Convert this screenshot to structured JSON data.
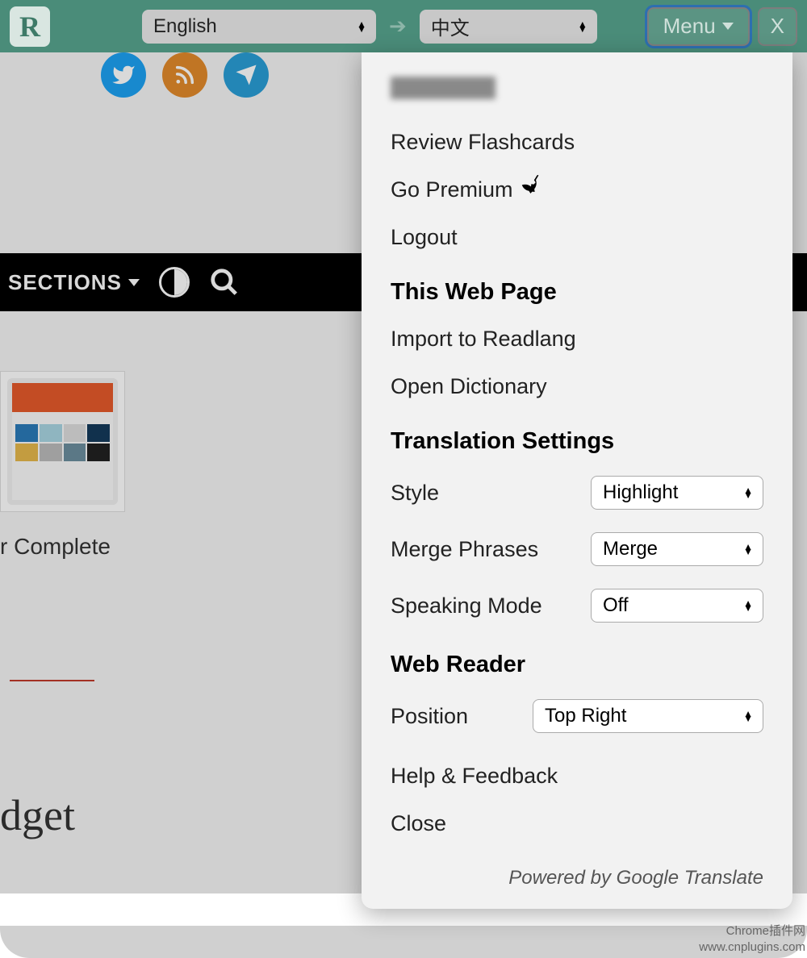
{
  "topbar": {
    "logo_letter": "R",
    "source_lang": "English",
    "target_lang": "中文",
    "menu_label": "Menu",
    "close_label": "X"
  },
  "social": {
    "twitter": "twitter-icon",
    "rss": "rss-icon",
    "telegram": "telegram-icon"
  },
  "sections_bar": {
    "label": "SECTIONS"
  },
  "article": {
    "title_fragment": "r Complete",
    "big_title_fragment": "dget"
  },
  "menu": {
    "review_flashcards": "Review Flashcards",
    "go_premium": "Go Premium",
    "logout": "Logout",
    "this_web_page_header": "This Web Page",
    "import_to_readlang": "Import to Readlang",
    "open_dictionary": "Open Dictionary",
    "translation_settings_header": "Translation Settings",
    "style_label": "Style",
    "style_value": "Highlight",
    "merge_label": "Merge Phrases",
    "merge_value": "Merge",
    "speaking_label": "Speaking Mode",
    "speaking_value": "Off",
    "web_reader_header": "Web Reader",
    "position_label": "Position",
    "position_value": "Top Right",
    "help_feedback": "Help & Feedback",
    "close": "Close",
    "powered_by": "Powered by Google Translate"
  },
  "footer": {
    "line1": "Chrome插件网",
    "line2": "www.cnplugins.com"
  }
}
